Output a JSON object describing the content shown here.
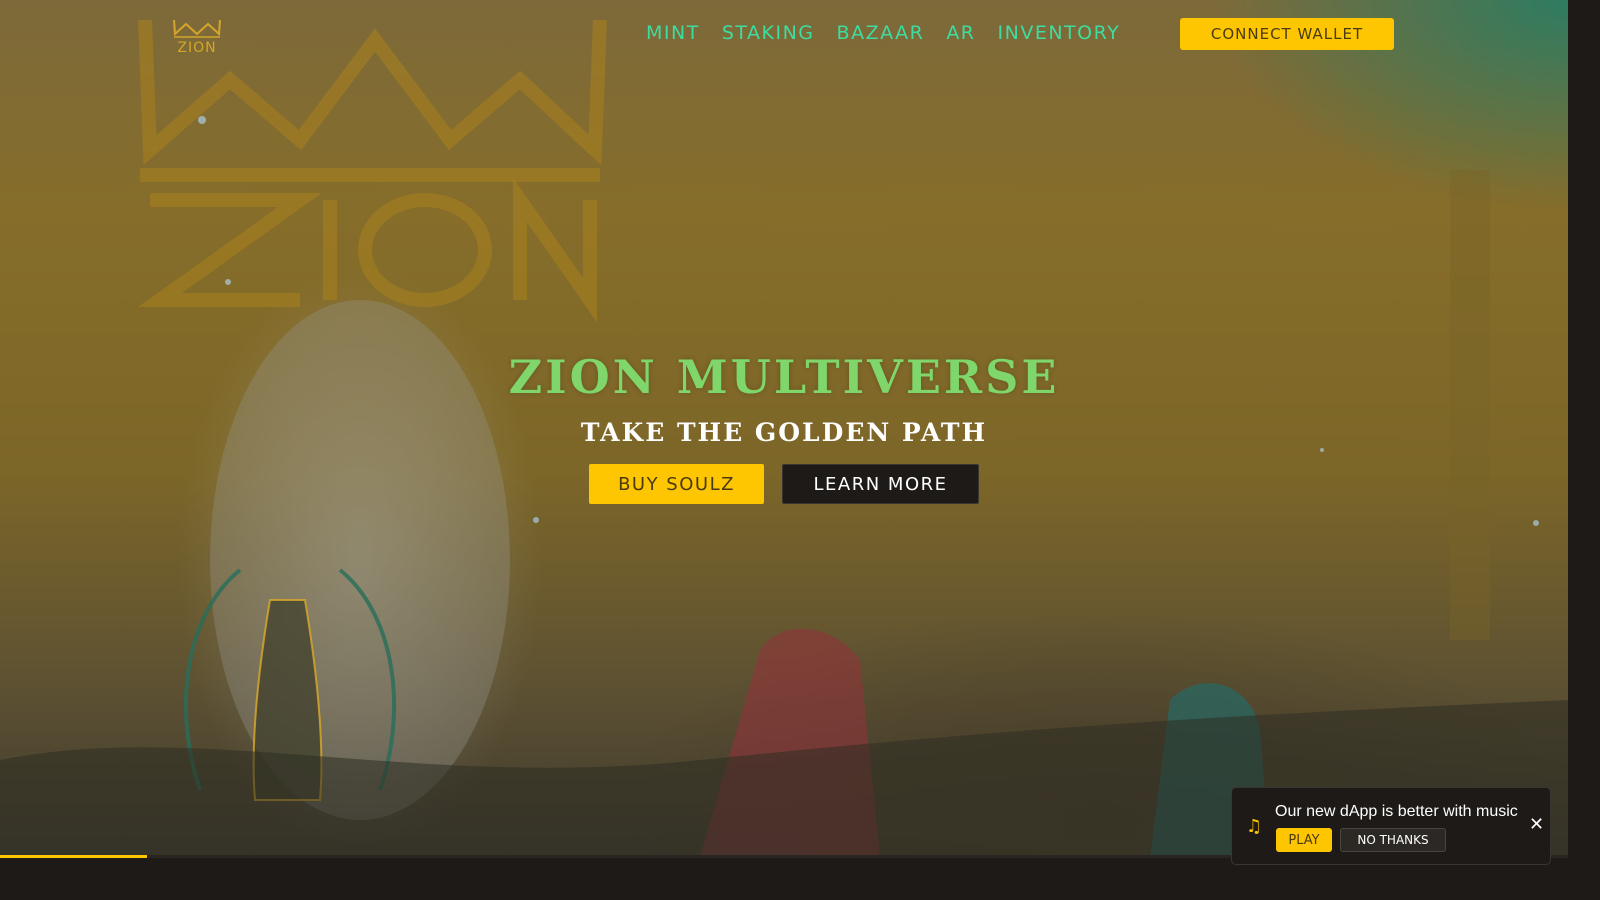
{
  "brand": {
    "logo_text": "ZION",
    "logo_icon": "crown-icon",
    "accent": "#fec601",
    "nav_color": "#3ddca0",
    "title_color": "#7fd66a"
  },
  "nav": {
    "items": [
      {
        "label": "MINT"
      },
      {
        "label": "STAKING"
      },
      {
        "label": "BAZAAR"
      },
      {
        "label": "AR"
      },
      {
        "label": "INVENTORY"
      }
    ],
    "connect_label": "CONNECT WALLET"
  },
  "hero": {
    "title": "ZION MULTIVERSE",
    "subtitle": "TAKE THE GOLDEN PATH",
    "buy_label": "BUY SOULZ",
    "learn_label": "LEARN MORE"
  },
  "progress": {
    "fraction": 0.094
  },
  "toast": {
    "icon": "music-note-icon",
    "message": "Our new dApp is better with music",
    "play_label": "PLAY",
    "decline_label": "NO THANKS",
    "close_icon": "close-icon"
  }
}
